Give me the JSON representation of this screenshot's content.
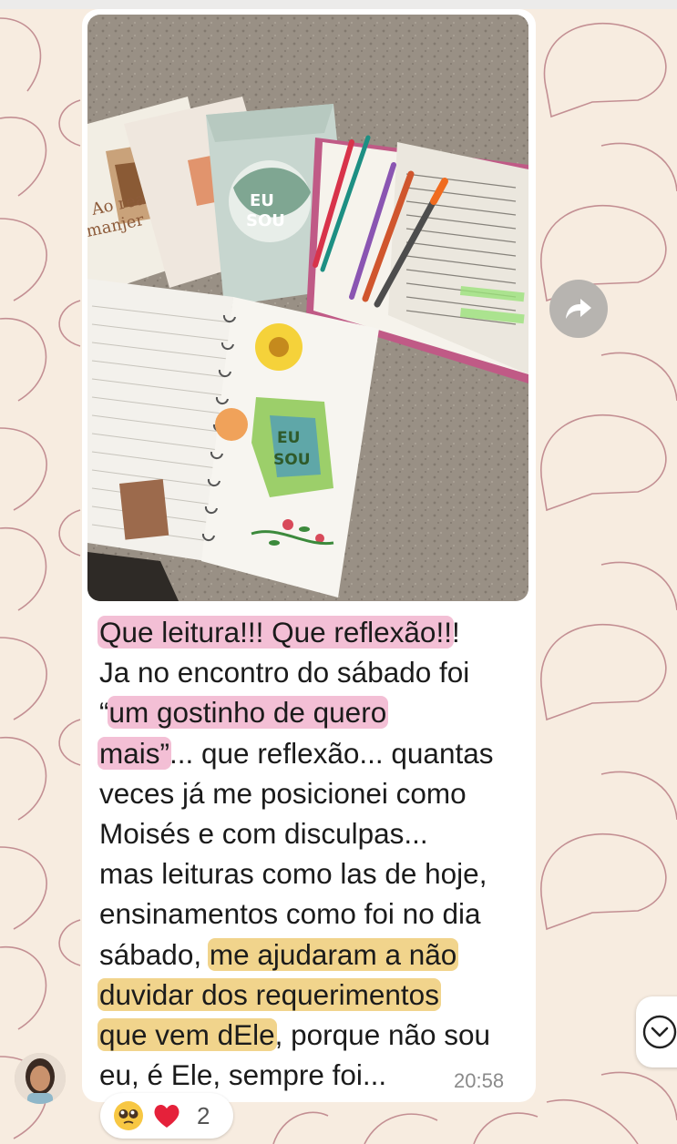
{
  "message": {
    "lines": [
      [
        {
          "t": "Que leitura!!! Que reflexão!!",
          "hl": "pink"
        },
        {
          "t": "!",
          "hl": ""
        }
      ],
      [
        {
          "t": "Ja no encontro do sábado foi",
          "hl": ""
        }
      ],
      [
        {
          "t": "“",
          "hl": ""
        },
        {
          "t": "um gostinho de quero",
          "hl": "pink"
        }
      ],
      [
        {
          "t": "mais”",
          "hl": "pink"
        },
        {
          "t": "... que reflexão... quantas",
          "hl": ""
        }
      ],
      [
        {
          "t": "veces já me posicionei como",
          "hl": ""
        }
      ],
      [
        {
          "t": "Moisés e com disculpas...",
          "hl": ""
        }
      ],
      [
        {
          "t": "mas leituras como las de hoje,",
          "hl": ""
        }
      ],
      [
        {
          "t": "ensinamentos como foi no dia",
          "hl": ""
        }
      ],
      [
        {
          "t": "sábado, ",
          "hl": ""
        },
        {
          "t": "me ajudaram a não",
          "hl": "yellow"
        }
      ],
      [
        {
          "t": "duvidar dos requerimentos",
          "hl": "yellow"
        }
      ],
      [
        {
          "t": "que vem dEle",
          "hl": "yellow"
        },
        {
          "t": ", porque não sou",
          "hl": ""
        }
      ],
      [
        {
          "t": "eu, é Ele, sempre foi...",
          "hl": ""
        }
      ]
    ],
    "time": "20:58"
  },
  "reactions": {
    "emojis": [
      "pleading-face",
      "red-heart"
    ],
    "count": "2"
  },
  "photo": {
    "book_cover_text": "EU SOU",
    "notebook_text": "EU SOU",
    "book_left_text": "Ao rea\nmanjer"
  },
  "colors": {
    "wallpaper": "#f7ece0",
    "wallpaper_pattern": "#b2707a",
    "bubble": "#ffffff",
    "highlight_pink": "#f3bfd5",
    "highlight_yellow": "#f1d48c",
    "time": "#8a8a8a"
  },
  "icons": {
    "forward": "forward-arrow-icon",
    "scroll_down": "chevron-down-icon"
  }
}
